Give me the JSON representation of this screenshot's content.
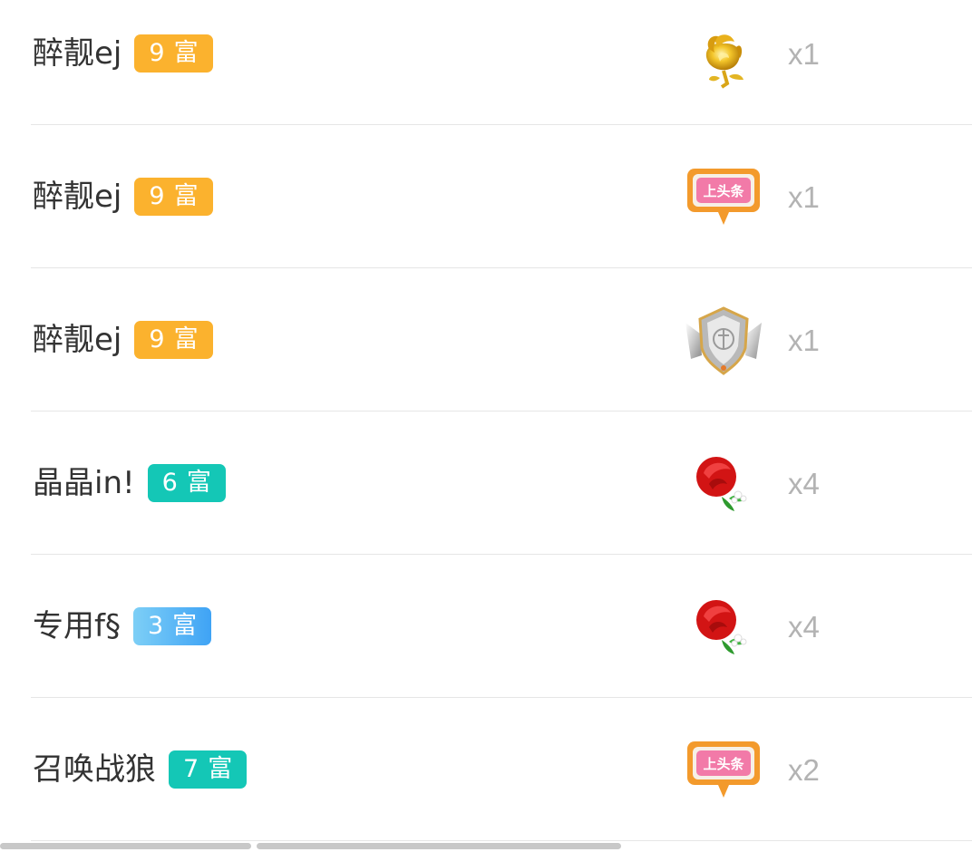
{
  "rows": [
    {
      "username": "醉靓ej",
      "level": "9",
      "badge_word": "富",
      "badge_color": "#fbb22e",
      "gift_icon": "gold-rose-icon",
      "count": "x1"
    },
    {
      "username": "醉靓ej",
      "level": "9",
      "badge_word": "富",
      "badge_color": "#fbb22e",
      "gift_icon": "headline-icon",
      "gift_text": "上头条",
      "count": "x1"
    },
    {
      "username": "醉靓ej",
      "level": "9",
      "badge_word": "富",
      "badge_color": "#fbb22e",
      "gift_icon": "guardian-shield-icon",
      "count": "x1"
    },
    {
      "username": "晶晶in!",
      "level": "6",
      "badge_word": "富",
      "badge_color": "#14c7b6",
      "gift_icon": "red-rose-icon",
      "count": "x4"
    },
    {
      "username": "专用f§",
      "level": "3",
      "badge_word": "富",
      "badge_color": "#5bb8f5",
      "gift_icon": "red-rose-icon",
      "count": "x4"
    },
    {
      "username": "召唤战狼",
      "level": "7",
      "badge_word": "富",
      "badge_color": "#14c7b6",
      "gift_icon": "headline-icon",
      "gift_text": "上头条",
      "count": "x2"
    }
  ]
}
